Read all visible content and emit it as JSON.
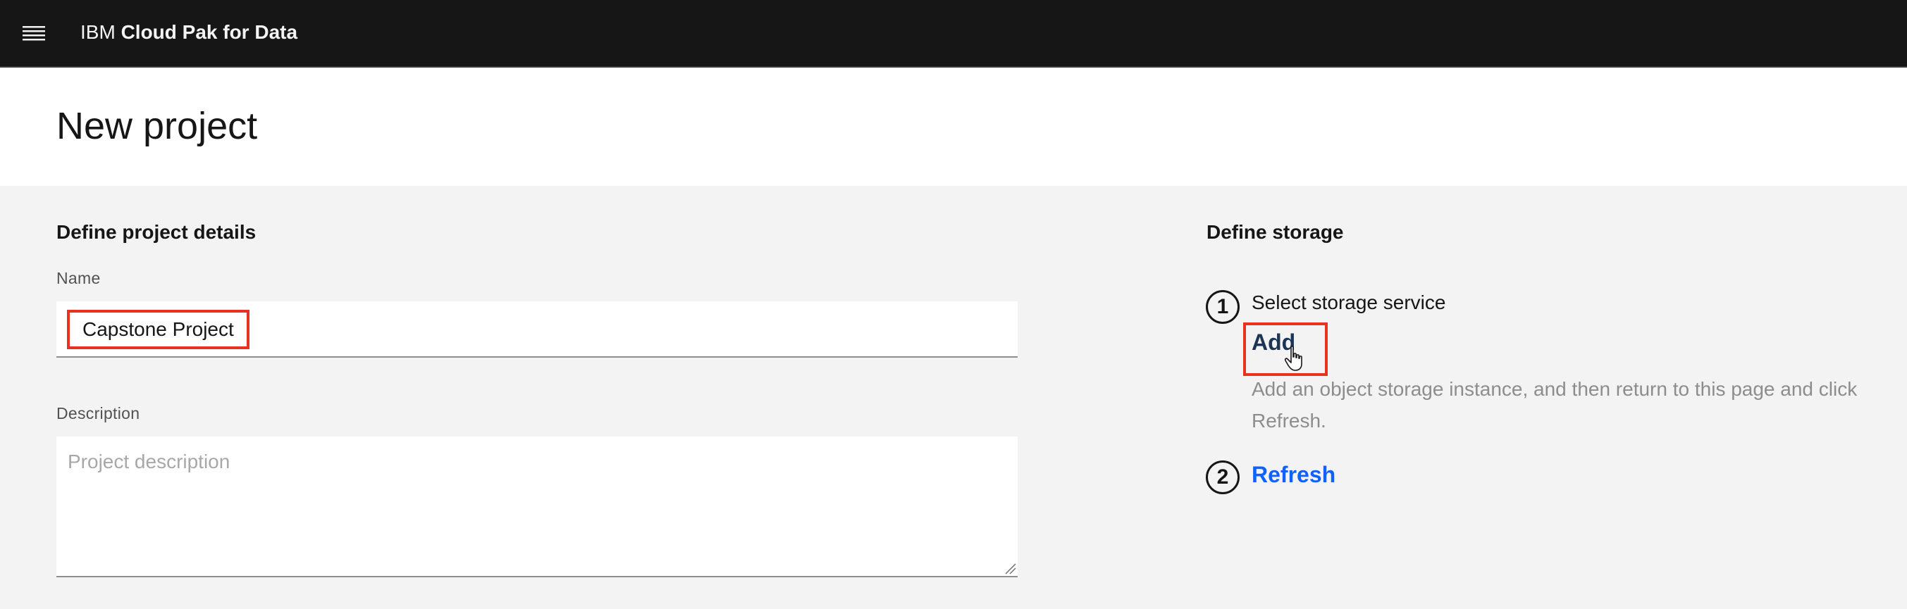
{
  "app": {
    "brand_prefix": "IBM",
    "brand_product": "Cloud Pak for Data"
  },
  "page": {
    "title": "New project"
  },
  "project_details": {
    "heading": "Define project details",
    "name_label": "Name",
    "name_value": "Capstone Project",
    "description_label": "Description",
    "description_placeholder": "Project description"
  },
  "storage": {
    "heading": "Define storage",
    "steps": [
      {
        "number": "1",
        "label": "Select storage service"
      },
      {
        "number": "2"
      }
    ],
    "add_label": "Add",
    "helper_text": "Add an object storage instance, and then return to this page and click Refresh.",
    "refresh_label": "Refresh"
  },
  "icons": {
    "menu": "hamburger-menu-icon",
    "cursor": "hand-pointer-icon",
    "resize": "resize-grip-icon"
  },
  "colors": {
    "topbar": "#161616",
    "highlight": "#e8321f",
    "link": "#0f62fe",
    "add_link": "#1c3554"
  }
}
